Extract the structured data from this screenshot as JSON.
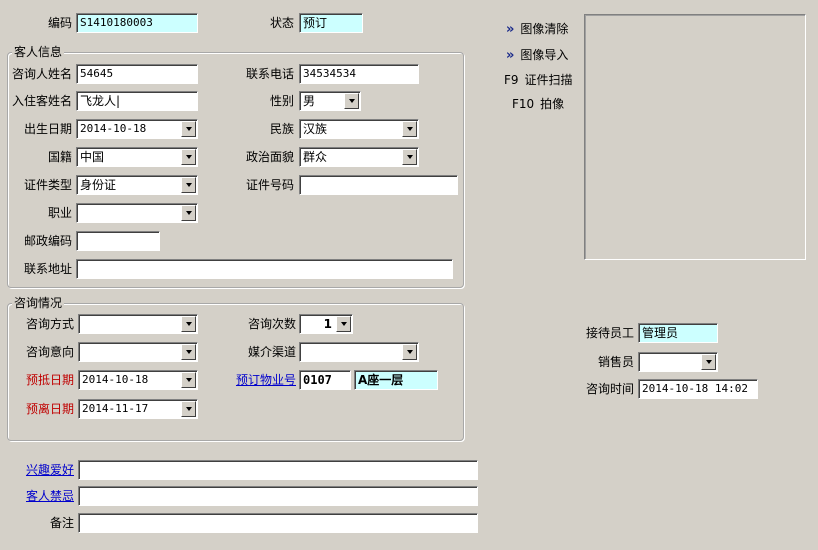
{
  "top": {
    "code_label": "编码",
    "code_value": "S1410180003",
    "status_label": "状态",
    "status_value": "预订"
  },
  "guest": {
    "title": "客人信息",
    "consult_name_label": "咨询人姓名",
    "consult_name_value": "54645",
    "phone_label": "联系电话",
    "phone_value": "34534534",
    "checkin_name_label": "入住客姓名",
    "checkin_name_value": "飞龙人|",
    "gender_label": "性别",
    "gender_value": "男",
    "birth_label": "出生日期",
    "birth_value": "2014-10-18",
    "ethnic_label": "民族",
    "ethnic_value": "汉族",
    "nation_label": "国籍",
    "nation_value": "中国",
    "politic_label": "政治面貌",
    "politic_value": "群众",
    "idtype_label": "证件类型",
    "idtype_value": "身份证",
    "idno_label": "证件号码",
    "idno_value": "",
    "job_label": "职业",
    "job_value": "",
    "zip_label": "邮政编码",
    "zip_value": "",
    "address_label": "联系地址",
    "address_value": ""
  },
  "consult": {
    "title": "咨询情况",
    "method_label": "咨询方式",
    "method_value": "",
    "count_label": "咨询次数",
    "count_value": "1",
    "intent_label": "咨询意向",
    "intent_value": "",
    "media_label": "媒介渠道",
    "media_value": "",
    "arrive_label": "预抵日期",
    "arrive_value": "2014-10-18",
    "property_label": "预订物业号",
    "property_code": "0107",
    "property_name": "A座一层",
    "leave_label": "预离日期",
    "leave_value": "2014-11-17"
  },
  "bottom": {
    "hobby_label": "兴趣爱好",
    "hobby_value": "",
    "taboo_label": "客人禁忌",
    "taboo_value": "",
    "remark_label": "备注",
    "remark_value": ""
  },
  "image_actions": {
    "clear_label": "图像清除",
    "import_label": "图像导入",
    "scan_key": "F9",
    "scan_label": "证件扫描",
    "photo_key": "F10",
    "photo_label": "拍像"
  },
  "staff": {
    "receptionist_label": "接待员工",
    "receptionist_value": "管理员",
    "sales_label": "销售员",
    "sales_value": "",
    "time_label": "咨询时间",
    "time_value": "2014-10-18 14:02"
  },
  "colors": {
    "background": "#d4d0c8",
    "highlight_field": "#ccffff",
    "required_label": "#c00000",
    "link": "#0000cc"
  }
}
